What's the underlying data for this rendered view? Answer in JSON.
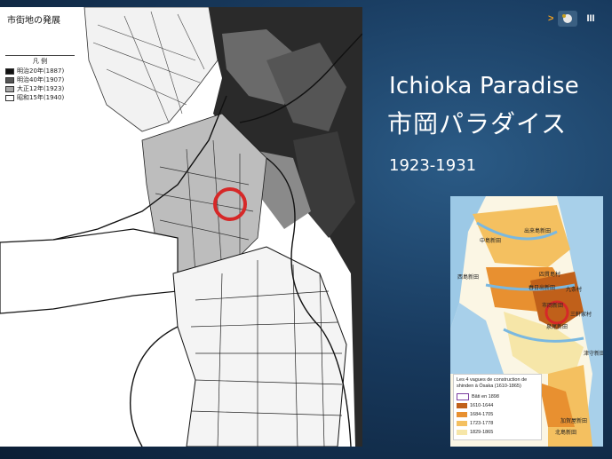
{
  "slide": {
    "title_en": "Ichioka Paradise",
    "title_jp": "市岡パラダイス",
    "years": "1923-1931"
  },
  "nav": {
    "arrow": ">",
    "page": "III"
  },
  "main_map": {
    "title": "市街地の発展",
    "legend_heading": "凡 例",
    "legend_items": [
      {
        "label": "明治20年(1887)",
        "color": "#111111"
      },
      {
        "label": "明治40年(1907)",
        "color": "#555555"
      },
      {
        "label": "大正12年(1923)",
        "color": "#a8a8a8"
      },
      {
        "label": "昭和15年(1940)",
        "color": "#ffffff"
      }
    ]
  },
  "inset_map": {
    "place_labels": [
      "出来島新田",
      "中島新田",
      "西島新田",
      "四貫島村",
      "春日出新田",
      "九条村",
      "市岡新田",
      "三軒家村",
      "泉尾新田",
      "津守新田",
      "加賀屋新田",
      "北島新田"
    ],
    "legend_title": "Les 4 vagues de construction de shinden à Ōsaka (1610-1865)",
    "legend_items": [
      {
        "label": "Bâti en 1898",
        "color": "#7b3fa0"
      },
      {
        "label": "1610-1644",
        "color": "#c0601a"
      },
      {
        "label": "1684-1705",
        "color": "#e89030"
      },
      {
        "label": "1723-1778",
        "color": "#f4c060"
      },
      {
        "label": "1829-1865",
        "color": "#f6e6a8"
      }
    ]
  }
}
